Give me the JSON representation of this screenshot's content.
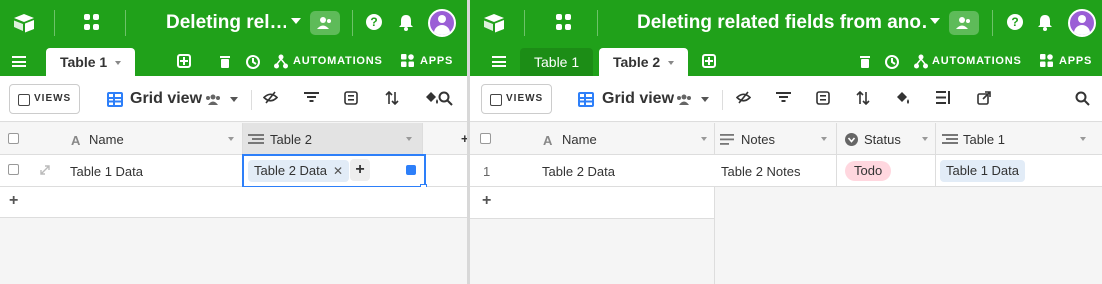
{
  "colors": {
    "brand": "#20a11a",
    "accent": "#2d7ff9",
    "chip": "#e2ecf7",
    "todo": "#ffd7df"
  },
  "left": {
    "base_title": "Deleting rel…",
    "tabs": [
      {
        "label": "Table 1"
      }
    ],
    "toolbar": {
      "automations": "AUTOMATIONS",
      "apps": "APPS"
    },
    "views_label": "VIEWS",
    "view_name": "Grid view",
    "columns": [
      "Name",
      "Table 2"
    ],
    "row": {
      "name": "Table 1 Data",
      "linked": "Table 2 Data"
    }
  },
  "right": {
    "base_title": "Deleting related fields from ano…",
    "tabs": [
      {
        "label": "Table 1"
      },
      {
        "label": "Table 2"
      }
    ],
    "toolbar": {
      "automations": "AUTOMATIONS",
      "apps": "APPS"
    },
    "views_label": "VIEWS",
    "view_name": "Grid view",
    "columns": [
      "Name",
      "Notes",
      "Status",
      "Table 1"
    ],
    "row": {
      "number": "1",
      "name": "Table 2 Data",
      "notes": "Table 2 Notes",
      "status": "Todo",
      "linked": "Table 1 Data"
    }
  }
}
